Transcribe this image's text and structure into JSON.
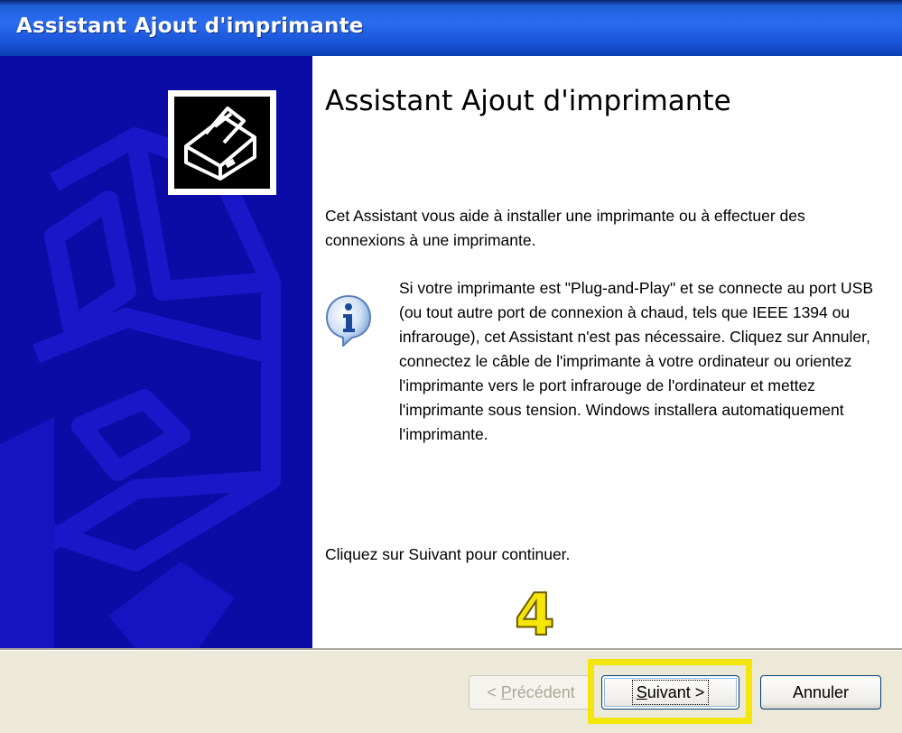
{
  "window": {
    "title": "Assistant Ajout d'imprimante"
  },
  "main": {
    "heading": "Assistant Ajout d'imprimante",
    "intro": "Cet Assistant vous aide à installer une imprimante ou à effectuer des connexions à une imprimante.",
    "info": "Si votre imprimante est \"Plug-and-Play\" et se connecte au port USB (ou tout autre port de connexion à chaud, tels que IEEE 1394 ou infrarouge), cet Assistant n'est pas nécessaire. Cliquez sur Annuler, connectez le câble de l'imprimante à votre ordinateur ou orientez l'imprimante vers le port infrarouge de l'ordinateur et mettez l'imprimante sous tension. Windows installera automatiquement l'imprimante.",
    "continue": "Cliquez sur Suivant pour continuer."
  },
  "annotation": {
    "step": "4",
    "color": "#f5e60a"
  },
  "buttons": {
    "prev": {
      "prefix": "< ",
      "underlined": "P",
      "rest": "récédent"
    },
    "next": {
      "underlined": "S",
      "rest": "uivant >"
    },
    "cancel": "Annuler"
  },
  "icons": {
    "banner": "printer-icon",
    "info": "info-icon"
  },
  "colors": {
    "banner": "#0b0ba6",
    "titlebar": "#1d5fd6",
    "dialog": "#ece9d8"
  }
}
